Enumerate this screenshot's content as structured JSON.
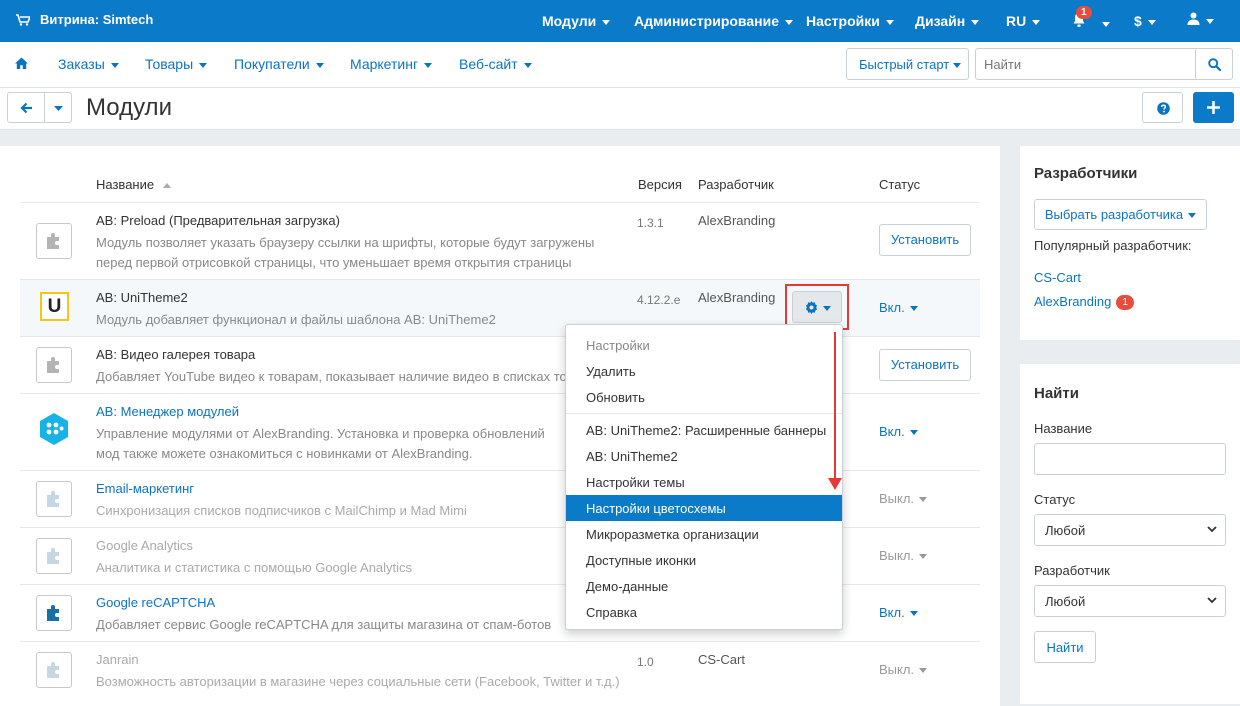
{
  "topbar": {
    "store_label": "Витрина: Simtech",
    "menus": [
      "Модули",
      "Администрирование",
      "Настройки",
      "Дизайн",
      "RU"
    ],
    "notifications_count": "1",
    "currency": "$"
  },
  "nav": {
    "items": [
      "Заказы",
      "Товары",
      "Покупатели",
      "Маркетинг",
      "Веб-сайт"
    ],
    "quick_start": "Быстрый старт",
    "search_placeholder": "Найти"
  },
  "page": {
    "title": "Модули"
  },
  "table": {
    "headers": {
      "name": "Название",
      "version": "Версия",
      "developer": "Разработчик",
      "status": "Статус"
    },
    "rows": [
      {
        "name": "AB: Preload (Предварительная загрузка)",
        "desc": "Модуль позволяет указать браузеру ссылки на шрифты, которые будут загружены перед первой отрисовкой страницы, что уменьшает время открытия страницы",
        "version": "1.3.1",
        "developer": "AlexBranding",
        "action": "Установить"
      },
      {
        "name": "AB: UniTheme2",
        "desc": "Модуль добавляет функционал и файлы шаблона AB: UniTheme2",
        "version": "4.12.2.e",
        "developer": "AlexBranding",
        "status": "Вкл."
      },
      {
        "name": "AB: Видео галерея товара",
        "desc": "Добавляет YouTube видео к товарам, показывает наличие видео в списках тов",
        "action": "Установить"
      },
      {
        "name": "AB: Менеджер модулей",
        "desc": "Управление модулями от AlexBranding. Установка и проверка обновлений мод также можете ознакомиться с новинками от AlexBranding.",
        "status": "Вкл."
      },
      {
        "name": "Email-маркетинг",
        "desc": "Синхронизация списков подписчиков с MailChimp и Mad Mimi",
        "status": "Выкл."
      },
      {
        "name": "Google Analytics",
        "desc": "Аналитика и статистика с помощью Google Analytics",
        "status": "Выкл."
      },
      {
        "name": "Google reCAPTCHA",
        "desc": "Добавляет сервис Google reCAPTCHA для защиты магазина от спам-ботов",
        "status": "Вкл."
      },
      {
        "name": "Janrain",
        "desc": "Возможность авторизации в магазине через социальные сети (Facebook, Twitter и т.д.)",
        "version": "1.0",
        "developer": "CS-Cart",
        "status": "Выкл."
      }
    ]
  },
  "dropdown": {
    "items": [
      "Настройки",
      "Удалить",
      "Обновить",
      "AB: UniTheme2: Расширенные баннеры",
      "AB: UniTheme2",
      "Настройки темы",
      "Настройки цветосхемы",
      "Микроразметка организации",
      "Доступные иконки",
      "Демо-данные",
      "Справка"
    ]
  },
  "sidebar": {
    "developers": {
      "title": "Разработчики",
      "select_button": "Выбрать разработчика",
      "popular_label": "Популярный разработчик:",
      "links": [
        "CS-Cart",
        "AlexBranding"
      ],
      "alexbranding_badge": "1"
    },
    "search": {
      "title": "Найти",
      "name_label": "Название",
      "status_label": "Статус",
      "status_value": "Любой",
      "developer_label": "Разработчик",
      "developer_value": "Любой",
      "submit": "Найти"
    }
  },
  "colors": {
    "primary": "#0b7ac8",
    "accent_red": "#e53935",
    "badge": "#e74c3c"
  }
}
